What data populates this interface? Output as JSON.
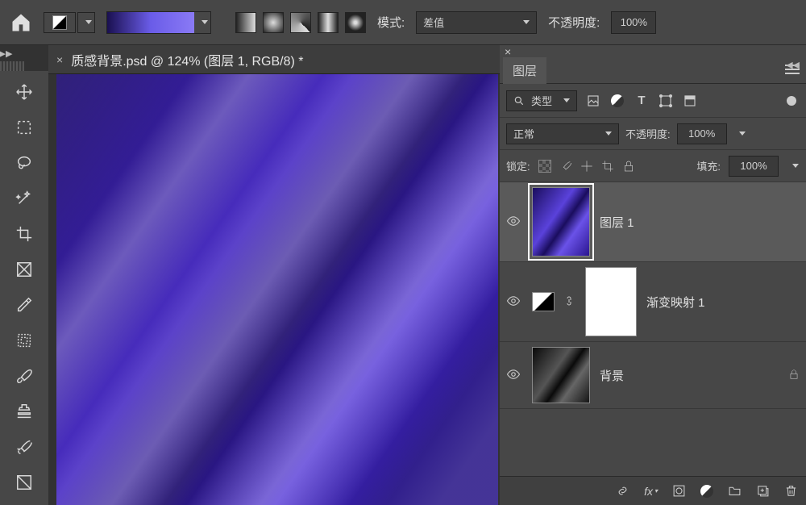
{
  "topbar": {
    "mode_label": "模式:",
    "mode_value": "差值",
    "opacity_label": "不透明度:",
    "opacity_value": "100%"
  },
  "document": {
    "tab_title": "质感背景.psd @ 124% (图层 1, RGB/8) *"
  },
  "layers_panel": {
    "title": "图层",
    "filter_label": "类型",
    "blend_mode": "正常",
    "opacity_label": "不透明度:",
    "opacity_value": "100%",
    "lock_label": "锁定:",
    "fill_label": "填充:",
    "fill_value": "100%",
    "layers": [
      {
        "name": "图层 1"
      },
      {
        "name": "渐变映射 1"
      },
      {
        "name": "背景"
      }
    ]
  }
}
